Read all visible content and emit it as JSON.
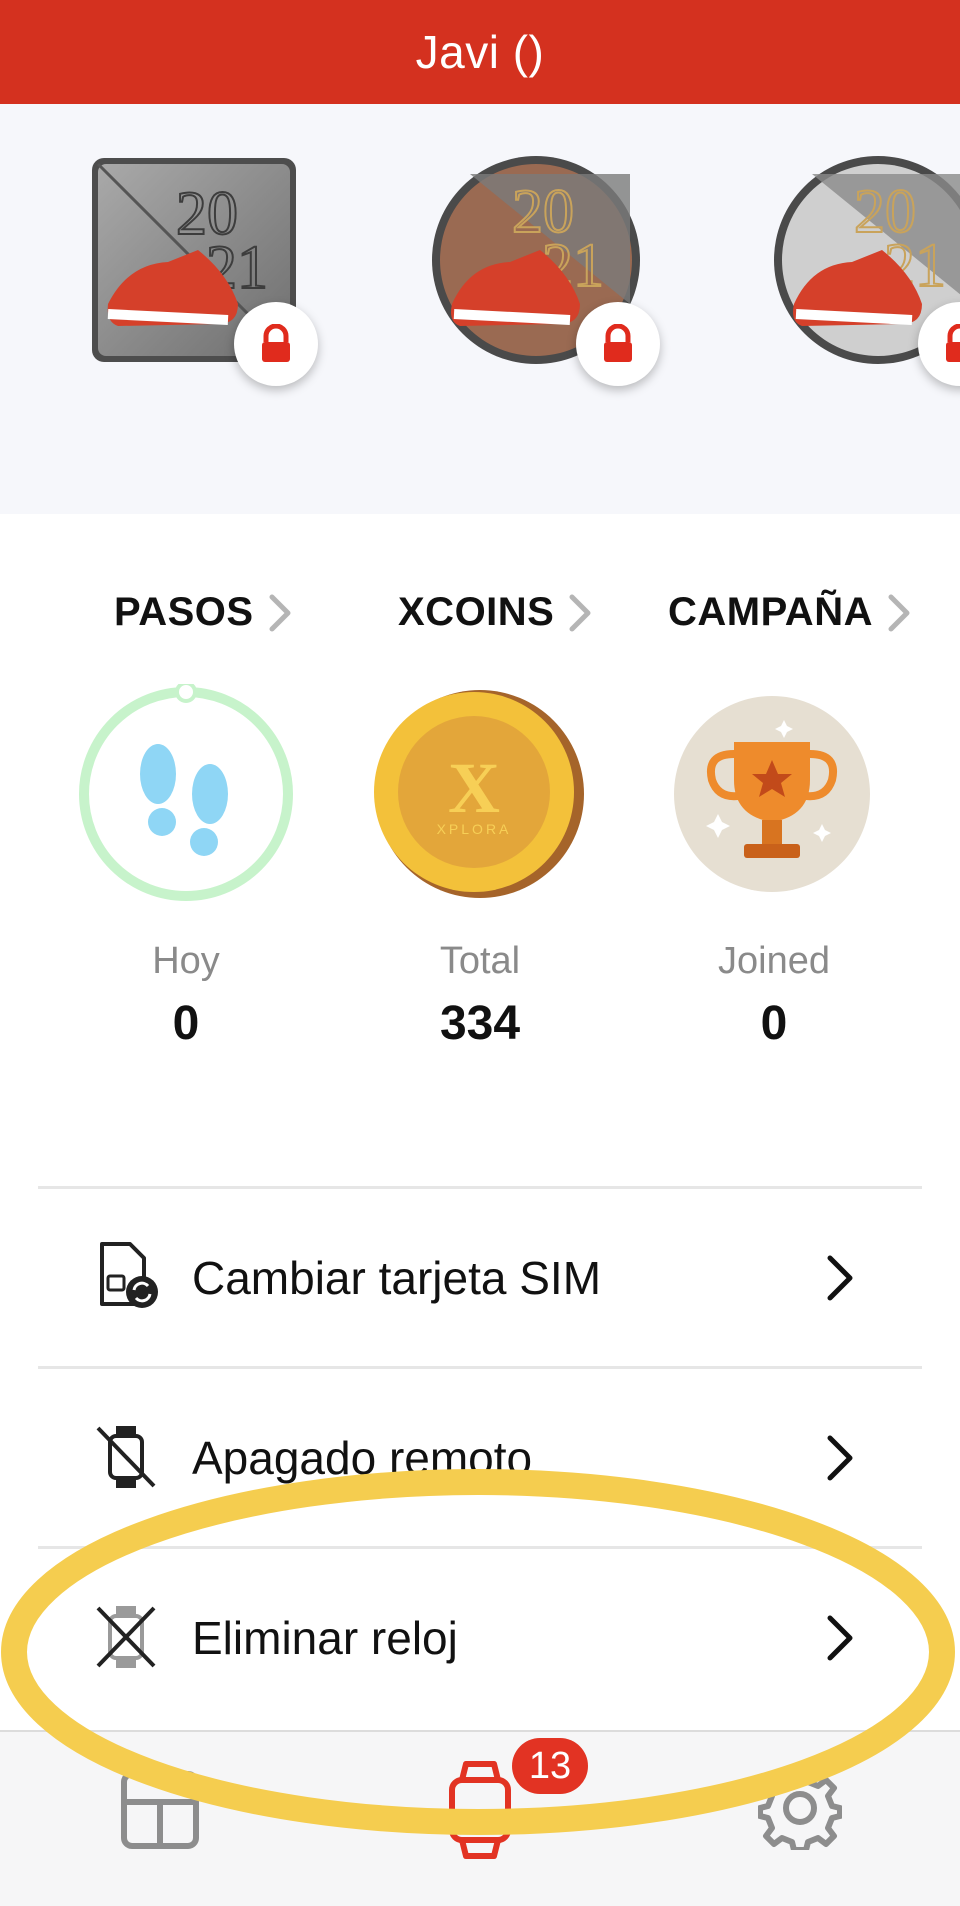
{
  "header": {
    "title": "Javi ()"
  },
  "colors": {
    "brand_red": "#d4311f",
    "highlight_yellow": "#f5cd4f",
    "badge_red": "#e23323"
  },
  "badges": [
    {
      "name": "2021 silver shoe medal",
      "locked": true
    },
    {
      "name": "2021 bronze shoe medal",
      "locked": true
    },
    {
      "name": "2021 silver round shoe medal",
      "locked": true
    }
  ],
  "stats": [
    {
      "label": "PASOS",
      "sublabel": "Hoy",
      "value": "0",
      "icon": "footsteps-icon"
    },
    {
      "label": "XCOINS",
      "sublabel": "Total",
      "value": "334",
      "icon": "xcoin-icon",
      "coin_text": "XPLORA"
    },
    {
      "label": "CAMPAÑA",
      "sublabel": "Joined",
      "value": "0",
      "icon": "trophy-icon"
    }
  ],
  "menu": [
    {
      "label": "Cambiar tarjeta SIM",
      "icon": "sim-card-swap-icon"
    },
    {
      "label": "Apagado remoto",
      "icon": "remote-power-off-icon"
    },
    {
      "label": "Eliminar reloj",
      "icon": "delete-watch-icon"
    }
  ],
  "tabbar": {
    "tabs": [
      {
        "name": "dashboard-tab",
        "icon": "layout-icon"
      },
      {
        "name": "watch-tab",
        "icon": "watch-icon",
        "active": true
      },
      {
        "name": "settings-tab",
        "icon": "gear-icon"
      }
    ],
    "notification_count": "13"
  }
}
